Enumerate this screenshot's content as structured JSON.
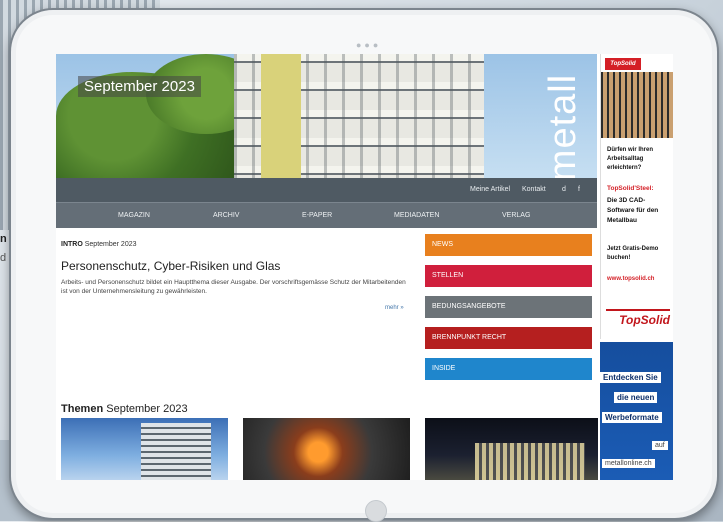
{
  "background": {
    "text_line_1": "n",
    "text_line_2": "d"
  },
  "hero": {
    "date_badge": "September 2023",
    "magazine_word": "metall"
  },
  "top_links": [
    "Meine Artikel",
    "Kontakt",
    "d",
    "f"
  ],
  "main_nav": [
    "MAGAZIN",
    "ARCHIV",
    "E-PAPER",
    "MEDIADATEN",
    "VERLAG"
  ],
  "intro": {
    "label": "INTRO",
    "issue": "September 2023",
    "title": "Personenschutz, Cyber-Risiken und Glas",
    "text": "Arbeits- und Personenschutz bildet ein Hauptthema dieser Ausgabe. Der vorschriftsgemässe Schutz der Mitarbeitenden ist von der Unternehmensleitung zu gewährleisten.",
    "more": "mehr »"
  },
  "categories": [
    {
      "label": "NEWS",
      "color": "#e8801e"
    },
    {
      "label": "STELLEN",
      "color": "#d01f3c"
    },
    {
      "label": "BEDUNGSANGEBOTE",
      "color": "#6c7378"
    },
    {
      "label": "BRENNPUNKT RECHT",
      "color": "#b51f1f"
    },
    {
      "label": "INSIDE",
      "color": "#1f86cc"
    }
  ],
  "themes": {
    "label": "Themen",
    "issue": "September 2023"
  },
  "ad_topsolid": {
    "logo": "TopSolid",
    "question": "Dürfen wir Ihren Arbeitsalltag erleichtern?",
    "product": "TopSolid'Steel:",
    "body": "Die 3D CAD-Software für den Metallbau",
    "demo": "Jetzt Gratis-Demo buchen!",
    "url": "www.topsolid.ch",
    "logo_bottom": "TopSolid"
  },
  "ad_werbe": {
    "l1": "Entdecken Sie",
    "l2": "die neuen",
    "l3": "Werbeformate",
    "l4": "auf",
    "l5": "metallonline.ch"
  }
}
